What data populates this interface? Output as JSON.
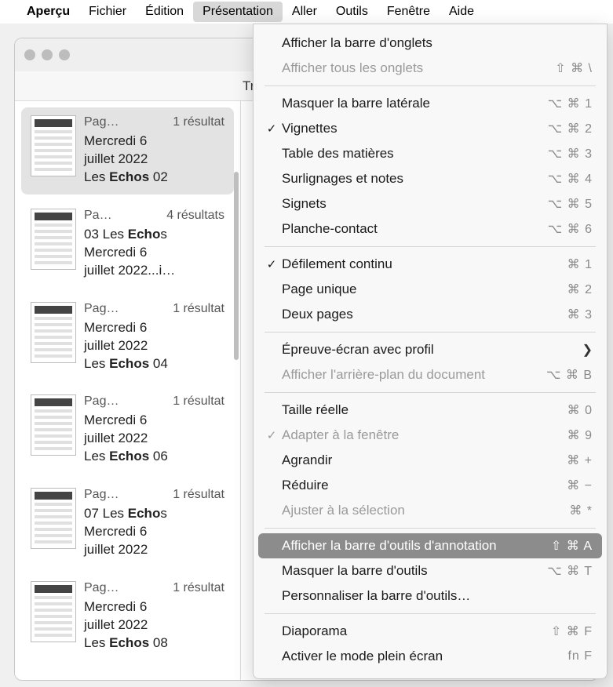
{
  "menubar": {
    "apple": "",
    "items": [
      "Aperçu",
      "Fichier",
      "Édition",
      "Présentation",
      "Aller",
      "Outils",
      "Fenêtre",
      "Aide"
    ],
    "active_index": 3
  },
  "toolbar": {
    "left_label": "Tri"
  },
  "sidebar": {
    "items": [
      {
        "page": "Pag…",
        "count": "1 résultat",
        "lines": [
          "Mercredi 6",
          "juillet 2022",
          "Les <b>Echos</b> 02"
        ],
        "selected": true
      },
      {
        "page": "Pa…",
        "count": "4 résultats",
        "lines": [
          "03 Les <b>Echo</b>s",
          "Mercredi 6",
          "juillet 2022...i…"
        ],
        "selected": false
      },
      {
        "page": "Pag…",
        "count": "1 résultat",
        "lines": [
          "Mercredi 6",
          "juillet 2022",
          "Les <b>Echos</b> 04"
        ],
        "selected": false
      },
      {
        "page": "Pag…",
        "count": "1 résultat",
        "lines": [
          "Mercredi 6",
          "juillet 2022",
          "Les <b>Echos</b> 06"
        ],
        "selected": false
      },
      {
        "page": "Pag…",
        "count": "1 résultat",
        "lines": [
          "07 Les <b>Echo</b>s",
          "Mercredi 6",
          "juillet 2022"
        ],
        "selected": false
      },
      {
        "page": "Pag…",
        "count": "1 résultat",
        "lines": [
          "Mercredi 6",
          "juillet 2022",
          "Les <b>Echos</b> 08"
        ],
        "selected": false
      }
    ]
  },
  "menu": {
    "groups": [
      [
        {
          "label": "Afficher la barre d'onglets",
          "shortcut": "",
          "check": false,
          "disabled": false
        },
        {
          "label": "Afficher tous les onglets",
          "shortcut": "⇧ ⌘ \\",
          "check": false,
          "disabled": true
        }
      ],
      [
        {
          "label": "Masquer la barre latérale",
          "shortcut": "⌥ ⌘ 1",
          "check": false
        },
        {
          "label": "Vignettes",
          "shortcut": "⌥ ⌘ 2",
          "check": true
        },
        {
          "label": "Table des matières",
          "shortcut": "⌥ ⌘ 3",
          "check": false
        },
        {
          "label": "Surlignages et notes",
          "shortcut": "⌥ ⌘ 4",
          "check": false
        },
        {
          "label": "Signets",
          "shortcut": "⌥ ⌘ 5",
          "check": false
        },
        {
          "label": "Planche-contact",
          "shortcut": "⌥ ⌘ 6",
          "check": false
        }
      ],
      [
        {
          "label": "Défilement continu",
          "shortcut": "⌘ 1",
          "check": true
        },
        {
          "label": "Page unique",
          "shortcut": "⌘ 2",
          "check": false
        },
        {
          "label": "Deux pages",
          "shortcut": "⌘ 3",
          "check": false
        }
      ],
      [
        {
          "label": "Épreuve-écran avec profil",
          "shortcut": "",
          "submenu": true
        },
        {
          "label": "Afficher l'arrière-plan du document",
          "shortcut": "⌥ ⌘ B",
          "disabled": true
        }
      ],
      [
        {
          "label": "Taille réelle",
          "shortcut": "⌘ 0"
        },
        {
          "label": "Adapter à la fenêtre",
          "shortcut": "⌘ 9",
          "check": true,
          "disabled": true
        },
        {
          "label": "Agrandir",
          "shortcut": "⌘ +"
        },
        {
          "label": "Réduire",
          "shortcut": "⌘ −"
        },
        {
          "label": "Ajuster à la sélection",
          "shortcut": "⌘ *",
          "disabled": true
        }
      ],
      [
        {
          "label": "Afficher la barre d'outils d'annotation",
          "shortcut": "⇧ ⌘ A",
          "highlight": true
        },
        {
          "label": "Masquer la barre d'outils",
          "shortcut": "⌥ ⌘ T"
        },
        {
          "label": "Personnaliser la barre d'outils…",
          "shortcut": ""
        }
      ],
      [
        {
          "label": "Diaporama",
          "shortcut": "⇧ ⌘ F"
        },
        {
          "label": "Activer le mode plein écran",
          "shortcut": "fn F"
        }
      ]
    ]
  }
}
